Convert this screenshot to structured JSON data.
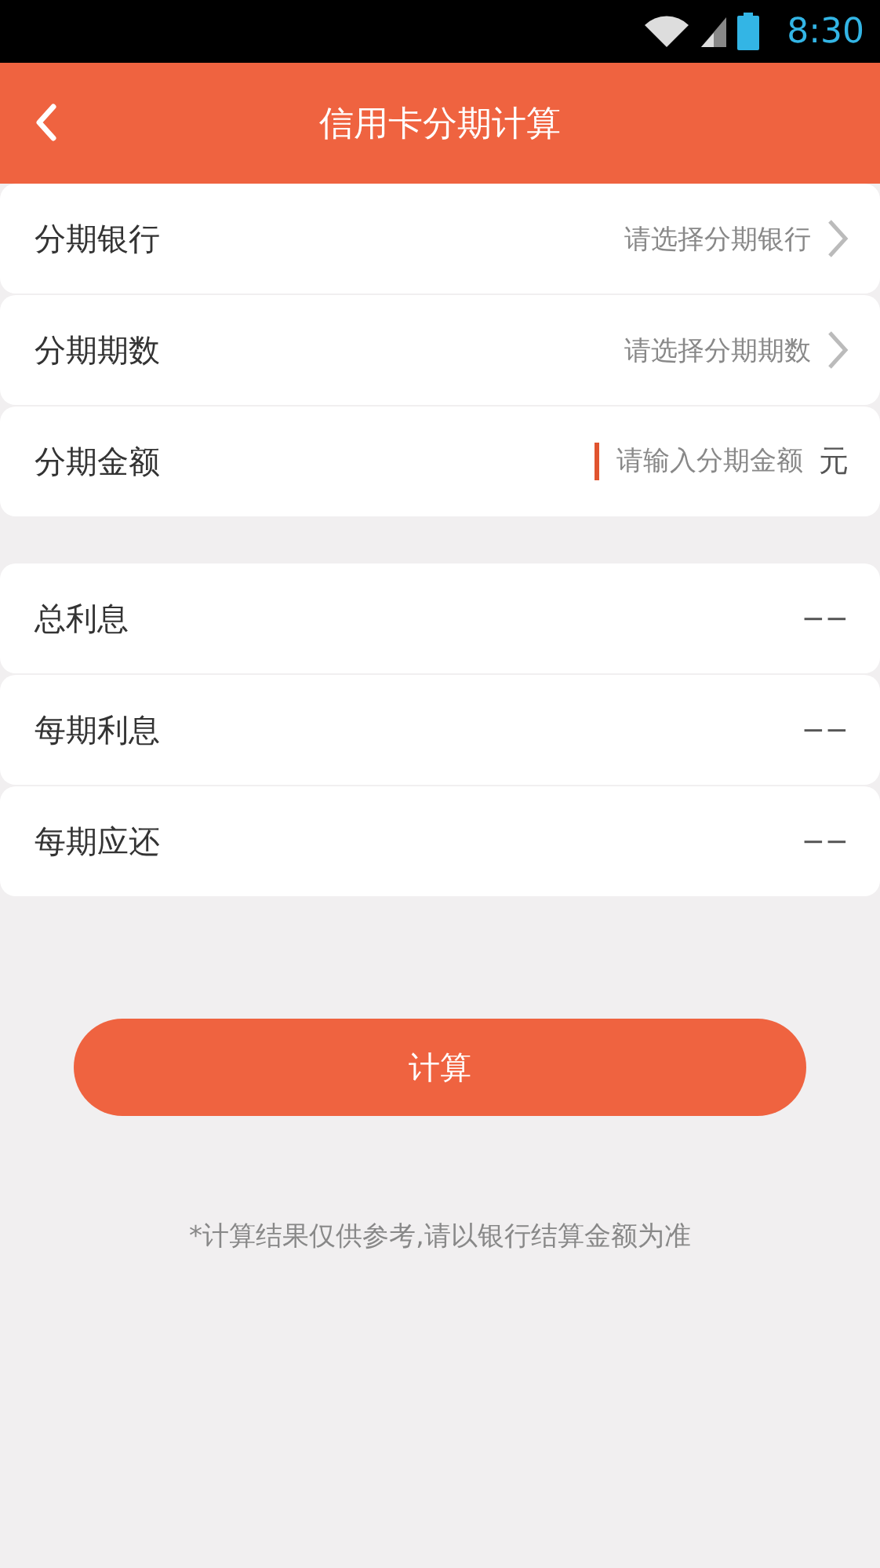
{
  "status_bar": {
    "time": "8:30"
  },
  "header": {
    "title": "信用卡分期计算"
  },
  "form_rows": [
    {
      "kind": "select",
      "label": "分期银行",
      "placeholder": "请选择分期银行"
    },
    {
      "kind": "select",
      "label": "分期期数",
      "placeholder": "请选择分期期数"
    },
    {
      "kind": "input",
      "label": "分期金额",
      "placeholder": "请输入分期金额",
      "unit": "元",
      "focused": true
    }
  ],
  "result_rows": [
    {
      "label": "总利息",
      "value": "−−"
    },
    {
      "label": "每期利息",
      "value": "−−"
    },
    {
      "label": "每期应还",
      "value": "−−"
    }
  ],
  "calculate_button": "计算",
  "footnote": "*计算结果仅供参考,请以银行结算金额为准"
}
